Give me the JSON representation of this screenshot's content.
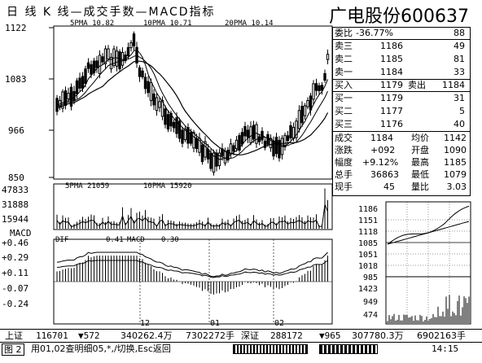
{
  "title_bar": {
    "chart_title": "日 线  K  线—成交手数—MACD指标",
    "stock_name": "广电股份600637"
  },
  "ma_legend": {
    "ma5": "5PMA  10.82",
    "ma10": "10PMA  10.71",
    "ma20": "20PMA  10.14"
  },
  "price_axis": [
    "1122",
    "1083",
    "966",
    "850"
  ],
  "volume_legend": {
    "v5": "5PMA  21059",
    "v10": "10PMA  15920"
  },
  "volume_axis": [
    "47833",
    "31888",
    "15944"
  ],
  "macd_label": "MACD",
  "macd_legend": {
    "dif": "DIF",
    "dif_val": "0.41",
    "macd": "MACD",
    "macd_val": "0.30"
  },
  "macd_axis": [
    "+0.46",
    "+0.29",
    "+0.11",
    "-0.07",
    "-0.24"
  ],
  "date_labels": [
    "12",
    "01",
    "02"
  ],
  "quote": {
    "wei_bi": {
      "label": "委比",
      "value": "-36.77%",
      "right": "88"
    },
    "sell_rows": [
      {
        "label": "卖三",
        "price": "1186",
        "qty": "49"
      },
      {
        "label": "卖二",
        "price": "1185",
        "qty": "81"
      },
      {
        "label": "卖一",
        "price": "1184",
        "qty": "33"
      }
    ],
    "trade_row": {
      "buy_label": "买入",
      "buy_price": "1179",
      "sell_label": "卖出",
      "sell_price": "1184"
    },
    "buy_rows": [
      {
        "label": "买一",
        "price": "1179",
        "qty": "31"
      },
      {
        "label": "买二",
        "price": "1177",
        "qty": "5"
      },
      {
        "label": "买三",
        "price": "1176",
        "qty": "40"
      }
    ],
    "stats": [
      {
        "l1": "成交",
        "v1": "1184",
        "l2": "均价",
        "v2": "1142"
      },
      {
        "l1": "涨跌",
        "v1": "+092",
        "l2": "开盘",
        "v2": "1090"
      },
      {
        "l1": "幅度",
        "v1": "+9.12%",
        "l2": "最高",
        "v2": "1185"
      },
      {
        "l1": "总手",
        "v1": "36863",
        "l2": "最低",
        "v2": "1079"
      },
      {
        "l1": "现手",
        "v1": "45",
        "l2": "量比",
        "v2": "3.03"
      }
    ]
  },
  "intraday_price_axis": [
    "1186",
    "1151",
    "1118",
    "1085",
    "1051",
    "1018",
    "985"
  ],
  "intraday_volume_axis": [
    "1423",
    "949",
    "474"
  ],
  "status": {
    "sh_label": "上证",
    "sh_index": "116701",
    "sh_change": "▼572",
    "sh_amount": "340262.4万",
    "sh_volume": "7302272手",
    "sz_label": "深证",
    "sz_index": "288172",
    "sz_change": "▼965",
    "sz_amount": "307780.3万",
    "sz_volume": "6902163手"
  },
  "bottom": {
    "fig_label": "图 2",
    "hint": "用01,02查明细05,*,/切换,Esc返回",
    "time": "14:15"
  }
}
